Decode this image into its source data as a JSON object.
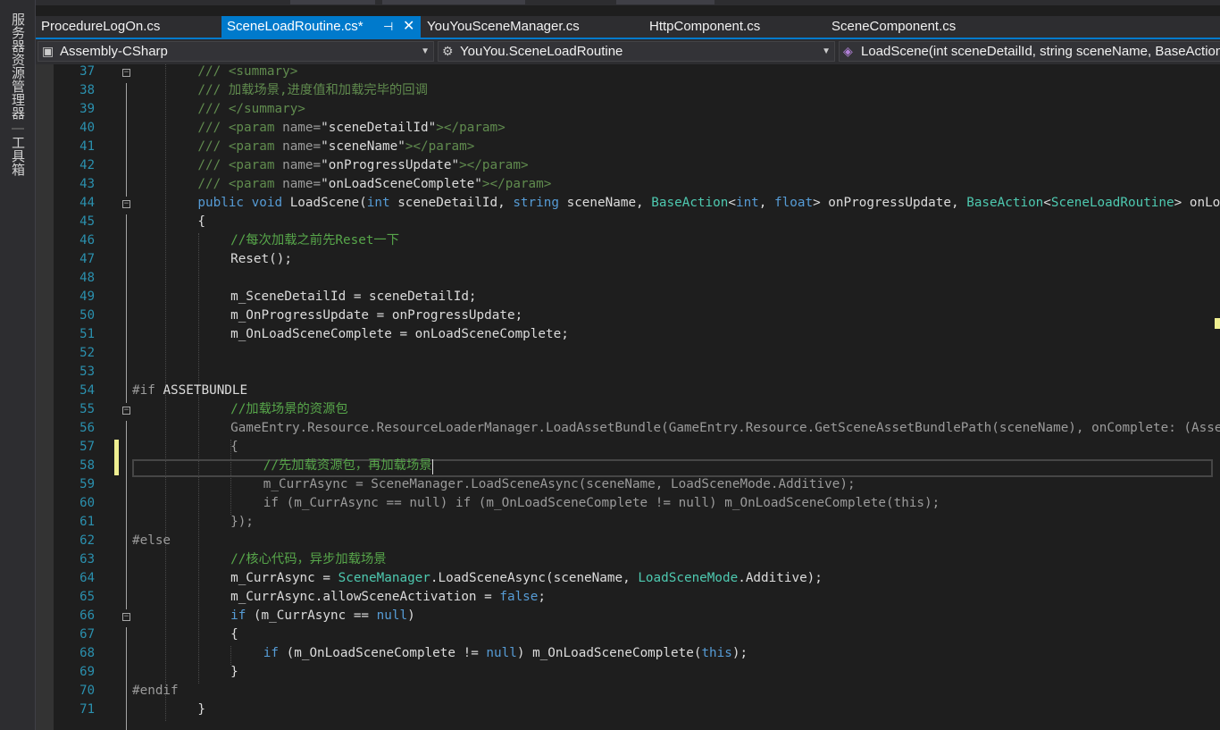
{
  "left_toolwindows": [
    {
      "label": "服务器资源管理器"
    },
    {
      "label": "工具箱"
    }
  ],
  "tabs": [
    {
      "label": "ProcedureLogOn.cs",
      "active": false
    },
    {
      "label": "SceneLoadRoutine.cs*",
      "active": true,
      "pin_icon": "pin-icon",
      "close_icon": "close-icon"
    },
    {
      "label": "YouYouSceneManager.cs",
      "active": false
    },
    {
      "label": "HttpComponent.cs",
      "active": false
    },
    {
      "label": "SceneComponent.cs",
      "active": false
    }
  ],
  "navbar": {
    "project": "Assembly-CSharp",
    "type": "YouYou.SceneLoadRoutine",
    "member": "LoadScene(int sceneDetailId, string sceneName, BaseAction<int, float> onProgressUpdate, BaseAction<SceneLoadRoutine> onLoadSceneComplete)"
  },
  "colors": {
    "accent": "#007acc",
    "line_number": "#2b91af",
    "comment": "#57a64a",
    "keyword": "#569cd6",
    "type": "#4ec9b0",
    "changed_marker": "#efef91"
  },
  "code": {
    "caret_line": 58,
    "lines": [
      {
        "n": "37",
        "indent": 2,
        "segs": [
          {
            "c": "doc",
            "t": "/// "
          },
          {
            "c": "tag",
            "t": "<summary>"
          }
        ]
      },
      {
        "n": "38",
        "indent": 2,
        "segs": [
          {
            "c": "doc",
            "t": "/// 加载场景,进度值和加载完毕的回调"
          }
        ]
      },
      {
        "n": "39",
        "indent": 2,
        "segs": [
          {
            "c": "doc",
            "t": "/// "
          },
          {
            "c": "tag",
            "t": "</summary>"
          }
        ]
      },
      {
        "n": "40",
        "indent": 2,
        "segs": [
          {
            "c": "doc",
            "t": "/// "
          },
          {
            "c": "tag",
            "t": "<param "
          },
          {
            "c": "gr",
            "t": "name="
          },
          {
            "c": "pl",
            "t": "\"sceneDetailId\""
          },
          {
            "c": "tag",
            "t": "></param>"
          }
        ]
      },
      {
        "n": "41",
        "indent": 2,
        "segs": [
          {
            "c": "doc",
            "t": "/// "
          },
          {
            "c": "tag",
            "t": "<param "
          },
          {
            "c": "gr",
            "t": "name="
          },
          {
            "c": "pl",
            "t": "\"sceneName\""
          },
          {
            "c": "tag",
            "t": "></param>"
          }
        ]
      },
      {
        "n": "42",
        "indent": 2,
        "segs": [
          {
            "c": "doc",
            "t": "/// "
          },
          {
            "c": "tag",
            "t": "<param "
          },
          {
            "c": "gr",
            "t": "name="
          },
          {
            "c": "pl",
            "t": "\"onProgressUpdate\""
          },
          {
            "c": "tag",
            "t": "></param>"
          }
        ]
      },
      {
        "n": "43",
        "indent": 2,
        "segs": [
          {
            "c": "doc",
            "t": "/// "
          },
          {
            "c": "tag",
            "t": "<param "
          },
          {
            "c": "gr",
            "t": "name="
          },
          {
            "c": "pl",
            "t": "\"onLoadSceneComplete\""
          },
          {
            "c": "tag",
            "t": "></param>"
          }
        ]
      },
      {
        "n": "44",
        "indent": 2,
        "segs": [
          {
            "c": "kw",
            "t": "public void "
          },
          {
            "c": "pl",
            "t": "LoadScene("
          },
          {
            "c": "kw",
            "t": "int "
          },
          {
            "c": "pl",
            "t": "sceneDetailId, "
          },
          {
            "c": "kw",
            "t": "string "
          },
          {
            "c": "pl",
            "t": "sceneName, "
          },
          {
            "c": "ty",
            "t": "BaseAction"
          },
          {
            "c": "pl",
            "t": "<"
          },
          {
            "c": "kw",
            "t": "int"
          },
          {
            "c": "pl",
            "t": ", "
          },
          {
            "c": "kw",
            "t": "float"
          },
          {
            "c": "pl",
            "t": "> onProgressUpdate, "
          },
          {
            "c": "ty",
            "t": "BaseAction"
          },
          {
            "c": "pl",
            "t": "<"
          },
          {
            "c": "ty",
            "t": "SceneLoadRoutine"
          },
          {
            "c": "pl",
            "t": "> onLoadSceneComplete)"
          }
        ]
      },
      {
        "n": "45",
        "indent": 2,
        "segs": [
          {
            "c": "pl",
            "t": "{"
          }
        ]
      },
      {
        "n": "46",
        "indent": 3,
        "segs": [
          {
            "c": "cm",
            "t": "//每次加载之前先Reset一下"
          }
        ]
      },
      {
        "n": "47",
        "indent": 3,
        "segs": [
          {
            "c": "pl",
            "t": "Reset();"
          }
        ]
      },
      {
        "n": "48",
        "indent": 3,
        "segs": []
      },
      {
        "n": "49",
        "indent": 3,
        "segs": [
          {
            "c": "pl",
            "t": "m_SceneDetailId = sceneDetailId;"
          }
        ]
      },
      {
        "n": "50",
        "indent": 3,
        "segs": [
          {
            "c": "pl",
            "t": "m_OnProgressUpdate = onProgressUpdate;"
          }
        ]
      },
      {
        "n": "51",
        "indent": 3,
        "segs": [
          {
            "c": "pl",
            "t": "m_OnLoadSceneComplete = onLoadSceneComplete;"
          }
        ]
      },
      {
        "n": "52",
        "indent": 3,
        "segs": []
      },
      {
        "n": "53",
        "indent": 3,
        "segs": []
      },
      {
        "n": "54",
        "indent": 0,
        "segs": [
          {
            "c": "pp",
            "t": "#if "
          },
          {
            "c": "pl",
            "t": "ASSETBUNDLE"
          }
        ]
      },
      {
        "n": "55",
        "indent": 3,
        "segs": [
          {
            "c": "cm",
            "t": "//加载场景的资源包"
          }
        ]
      },
      {
        "n": "56",
        "indent": 3,
        "segs": [
          {
            "c": "gr",
            "t": "GameEntry.Resource.ResourceLoaderManager.LoadAssetBundle(GameEntry.Resource.GetSceneAssetBundlePath(sceneName), onComplete: (AssetBundle bundle) =>"
          }
        ]
      },
      {
        "n": "57",
        "indent": 3,
        "segs": [
          {
            "c": "gr",
            "t": "{"
          }
        ]
      },
      {
        "n": "58",
        "indent": 4,
        "segs": [
          {
            "c": "cm",
            "t": "//先加载资源包，再加载场景"
          }
        ]
      },
      {
        "n": "59",
        "indent": 4,
        "segs": [
          {
            "c": "gr",
            "t": "m_CurrAsync = SceneManager.LoadSceneAsync(sceneName, LoadSceneMode.Additive);"
          }
        ]
      },
      {
        "n": "60",
        "indent": 4,
        "segs": [
          {
            "c": "gr",
            "t": "if (m_CurrAsync == null) if (m_OnLoadSceneComplete != null) m_OnLoadSceneComplete(this);"
          }
        ]
      },
      {
        "n": "61",
        "indent": 3,
        "segs": [
          {
            "c": "gr",
            "t": "});"
          }
        ]
      },
      {
        "n": "62",
        "indent": 0,
        "segs": [
          {
            "c": "pp",
            "t": "#else"
          }
        ]
      },
      {
        "n": "63",
        "indent": 3,
        "segs": [
          {
            "c": "cm",
            "t": "//核心代码，异步加载场景"
          }
        ]
      },
      {
        "n": "64",
        "indent": 3,
        "segs": [
          {
            "c": "pl",
            "t": "m_CurrAsync = "
          },
          {
            "c": "ty",
            "t": "SceneManager"
          },
          {
            "c": "pl",
            "t": ".LoadSceneAsync(sceneName, "
          },
          {
            "c": "ty",
            "t": "LoadSceneMode"
          },
          {
            "c": "pl",
            "t": ".Additive);"
          }
        ]
      },
      {
        "n": "65",
        "indent": 3,
        "segs": [
          {
            "c": "pl",
            "t": "m_CurrAsync.allowSceneActivation = "
          },
          {
            "c": "kw",
            "t": "false"
          },
          {
            "c": "pl",
            "t": ";"
          }
        ]
      },
      {
        "n": "66",
        "indent": 3,
        "segs": [
          {
            "c": "kw",
            "t": "if "
          },
          {
            "c": "pl",
            "t": "(m_CurrAsync == "
          },
          {
            "c": "kw",
            "t": "null"
          },
          {
            "c": "pl",
            "t": ")"
          }
        ]
      },
      {
        "n": "67",
        "indent": 3,
        "segs": [
          {
            "c": "pl",
            "t": "{"
          }
        ]
      },
      {
        "n": "68",
        "indent": 4,
        "segs": [
          {
            "c": "kw",
            "t": "if "
          },
          {
            "c": "pl",
            "t": "(m_OnLoadSceneComplete != "
          },
          {
            "c": "kw",
            "t": "null"
          },
          {
            "c": "pl",
            "t": ") m_OnLoadSceneComplete("
          },
          {
            "c": "kw",
            "t": "this"
          },
          {
            "c": "pl",
            "t": ");"
          }
        ]
      },
      {
        "n": "69",
        "indent": 3,
        "segs": [
          {
            "c": "pl",
            "t": "}"
          }
        ]
      },
      {
        "n": "70",
        "indent": 0,
        "segs": [
          {
            "c": "pp",
            "t": "#endif"
          }
        ]
      },
      {
        "n": "71",
        "indent": 2,
        "segs": [
          {
            "c": "pl",
            "t": "}"
          }
        ]
      }
    ]
  }
}
